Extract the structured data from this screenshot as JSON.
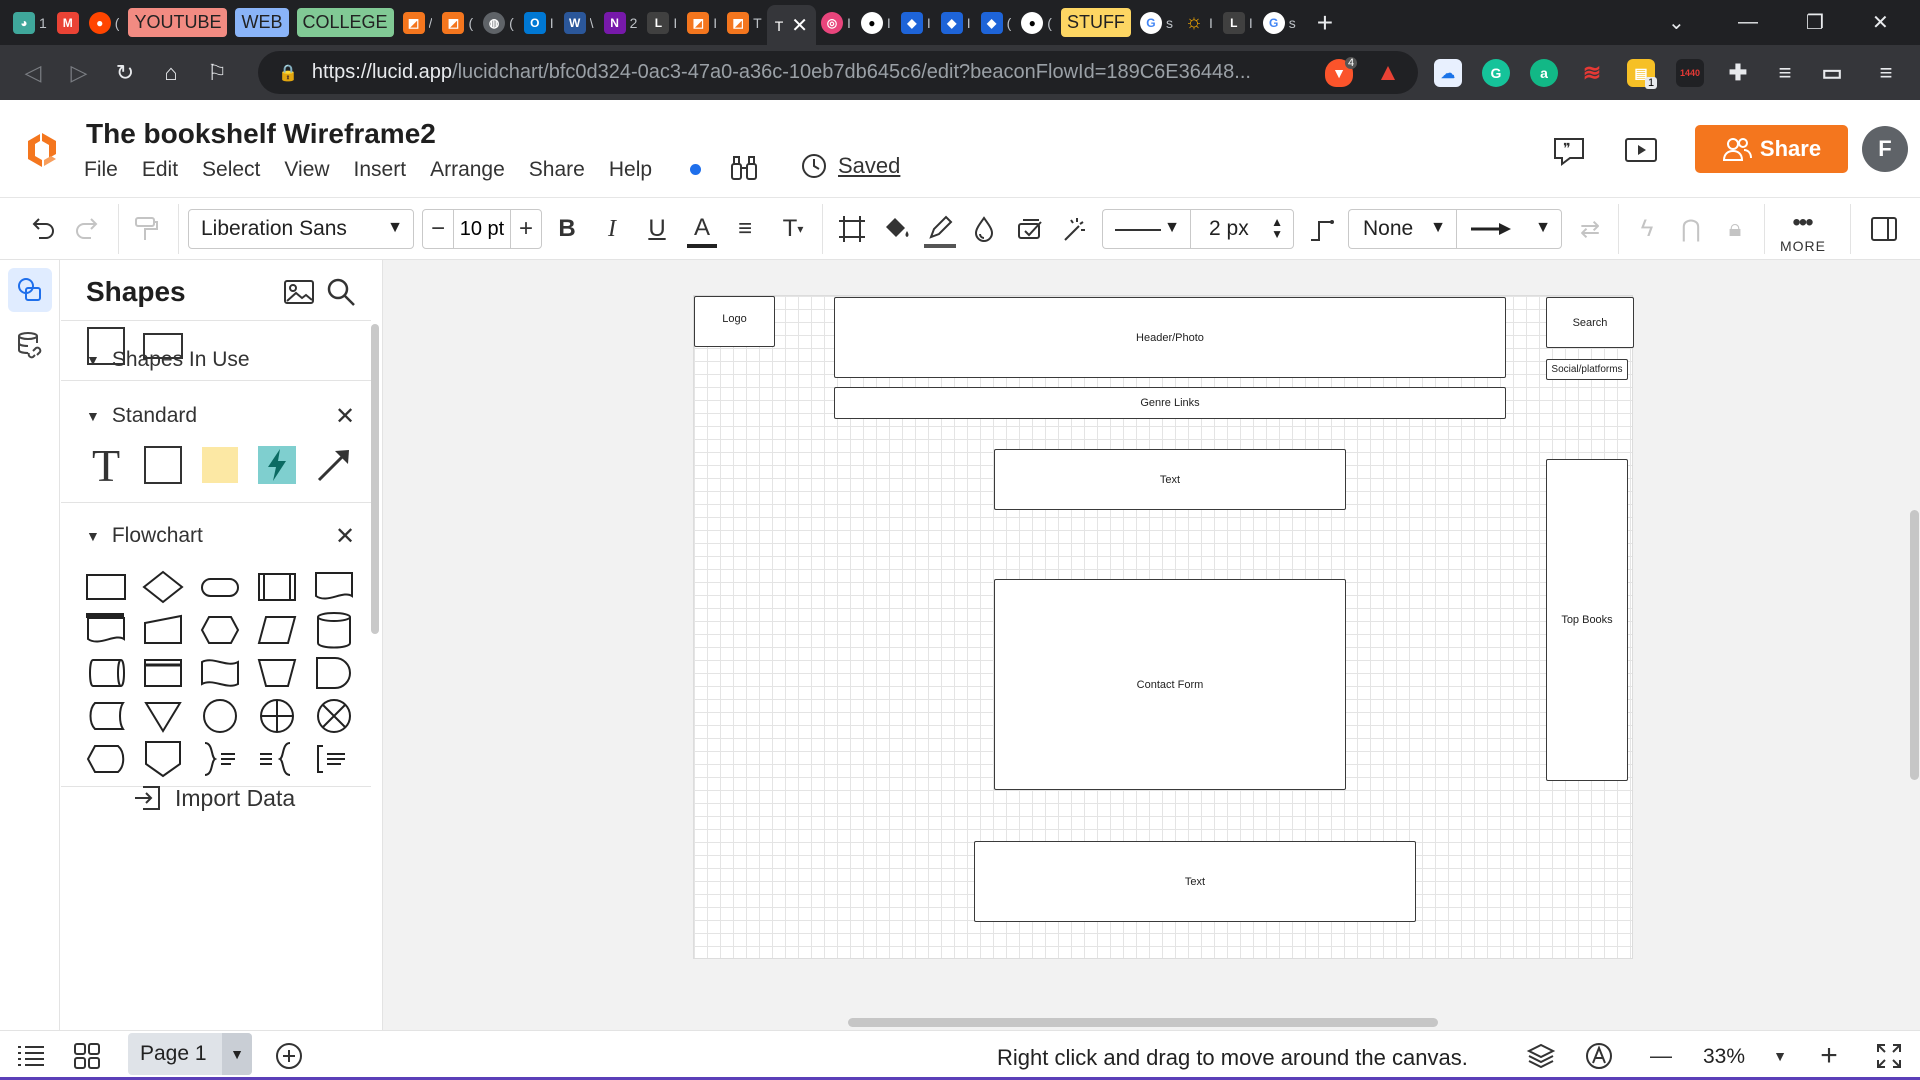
{
  "browser": {
    "tabs": [
      {
        "icon": "palette-icon",
        "color": "#3fa79b",
        "label": "1"
      },
      {
        "icon": "gmail-icon",
        "color": "#ea4335",
        "label": ""
      },
      {
        "icon": "reddit-icon",
        "color": "#ff4500",
        "label": "("
      },
      {
        "icon": "youtube-icon",
        "chip": "YOUTUBE",
        "chipColor": "#f28b82"
      },
      {
        "icon": "web-folder-icon",
        "chip": "WEB",
        "chipColor": "#8ab4f8"
      },
      {
        "icon": "college-folder-icon",
        "chip": "COLLEGE",
        "chipColor": "#81c995"
      },
      {
        "icon": "lucid-icon",
        "color": "#f4761e",
        "label": "/"
      },
      {
        "icon": "lucid-icon",
        "color": "#f4761e",
        "label": "("
      },
      {
        "icon": "globe-icon",
        "color": "#5f6368",
        "label": "("
      },
      {
        "icon": "outlook-icon",
        "color": "#0078d4",
        "label": "I"
      },
      {
        "icon": "word-icon",
        "color": "#2b579a",
        "label": "\\"
      },
      {
        "icon": "onenote-icon",
        "color": "#7719aa",
        "label": "2"
      },
      {
        "icon": "lucidspark-icon",
        "color": "#404040",
        "label": "I"
      },
      {
        "icon": "lucid-icon",
        "color": "#f4761e",
        "label": "I"
      },
      {
        "icon": "lucid-icon",
        "color": "#f4761e",
        "label": "T"
      },
      {
        "icon": "text-tab-icon",
        "color": "#35363a",
        "label": "",
        "active": true
      },
      {
        "icon": "record-icon",
        "color": "#e8457c",
        "label": "I"
      },
      {
        "icon": "github-icon",
        "color": "#24292e",
        "label": "I"
      },
      {
        "icon": "jira-icon",
        "color": "#1e64d8",
        "label": "I"
      },
      {
        "icon": "jira-icon",
        "color": "#1e64d8",
        "label": "I"
      },
      {
        "icon": "jira-icon",
        "color": "#1e64d8",
        "label": "("
      },
      {
        "icon": "github-icon",
        "color": "#24292e",
        "label": "("
      },
      {
        "icon": "stuff-folder-icon",
        "chip": "STUFF",
        "chipColor": "#fdd663"
      },
      {
        "icon": "google-icon",
        "color": "#4285f4",
        "label": "s"
      },
      {
        "icon": "sun-icon",
        "color": "#f9ab00",
        "label": "I"
      },
      {
        "icon": "lucidspark-icon",
        "color": "#404040",
        "label": "I"
      },
      {
        "icon": "google-icon",
        "color": "#4285f4",
        "label": "s"
      }
    ],
    "active_tab_title": "T",
    "url_host": "https://lucid.app",
    "url_path": "/lucidchart/bfc0d324-0ac3-47a0-a36c-10eb7db645c6/edit?beaconFlowId=189C6E36448...",
    "brave_badge": "4",
    "ext_badge": "1",
    "ext_1440": "1440"
  },
  "app": {
    "title": "The bookshelf Wireframe2",
    "menu": [
      "File",
      "Edit",
      "Select",
      "View",
      "Insert",
      "Arrange",
      "Share",
      "Help"
    ],
    "saved_label": "Saved",
    "share_label": "Share",
    "avatar_initial": "F",
    "brand_color": "#f4761e"
  },
  "toolbar": {
    "font_family": "Liberation Sans",
    "font_size": "10 pt",
    "line_width": "2 px",
    "line_start": "None",
    "more_label": "MORE"
  },
  "panel": {
    "title": "Shapes",
    "sections": [
      {
        "name": "Shapes In Use"
      },
      {
        "name": "Standard"
      },
      {
        "name": "Flowchart"
      }
    ],
    "import_label": "Import Data"
  },
  "canvas": {
    "shapes": [
      {
        "id": "logo",
        "label": "Logo"
      },
      {
        "id": "header",
        "label": "Header/Photo"
      },
      {
        "id": "search",
        "label": "Search"
      },
      {
        "id": "social",
        "label": "Social/platforms"
      },
      {
        "id": "genre",
        "label": "Genre Links"
      },
      {
        "id": "text1",
        "label": "Text"
      },
      {
        "id": "topbooks",
        "label": "Top Books"
      },
      {
        "id": "contact",
        "label": "Contact Form"
      },
      {
        "id": "text2",
        "label": "Text"
      }
    ]
  },
  "footer": {
    "page_label": "Page 1",
    "hint": "Right click and drag to move around the canvas.",
    "zoom": "33%"
  }
}
